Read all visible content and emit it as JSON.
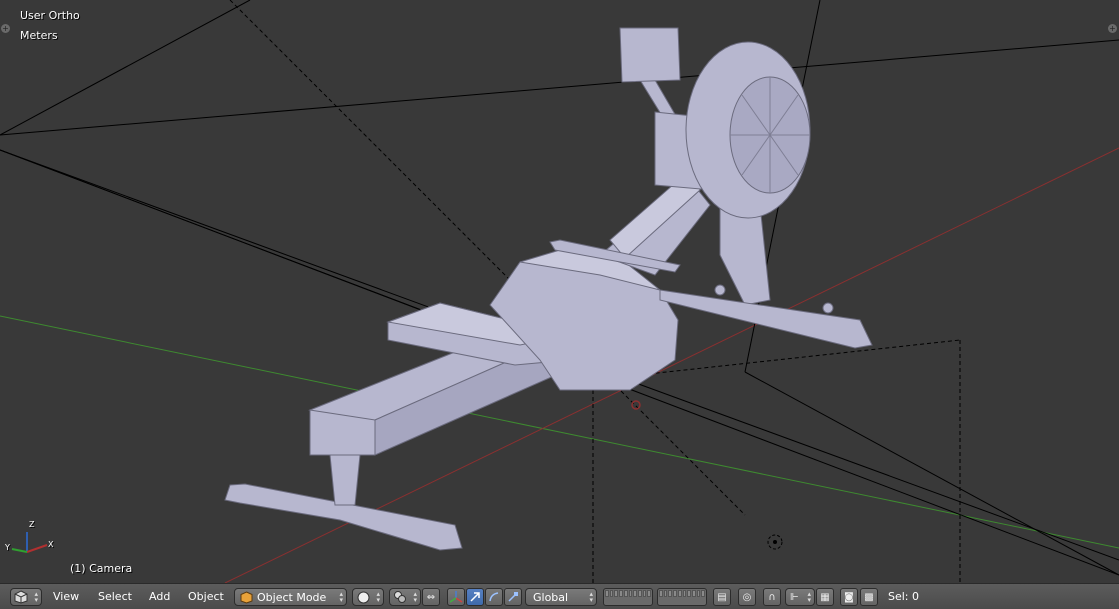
{
  "viewport": {
    "view_name": "User Ortho",
    "units": "Meters",
    "object_label": "(1) Camera",
    "axes": {
      "x": "X",
      "y": "Y",
      "z": "Z"
    }
  },
  "header": {
    "editor_type_icon": "cube-icon",
    "menus": [
      "View",
      "Select",
      "Add",
      "Object"
    ],
    "mode": "Object Mode",
    "shading_icon": "sphere-solid-icon",
    "pivot_icon": "pivot-icon",
    "orientation": "Global",
    "stats": "Sel: 0"
  },
  "colors": {
    "background": "#393939",
    "grid_x_axis": "#8b2f2f",
    "grid_y_axis": "#3f8b2f",
    "mesh": "#b7b7cf",
    "header": "#555555",
    "accent": "#5680c2"
  }
}
